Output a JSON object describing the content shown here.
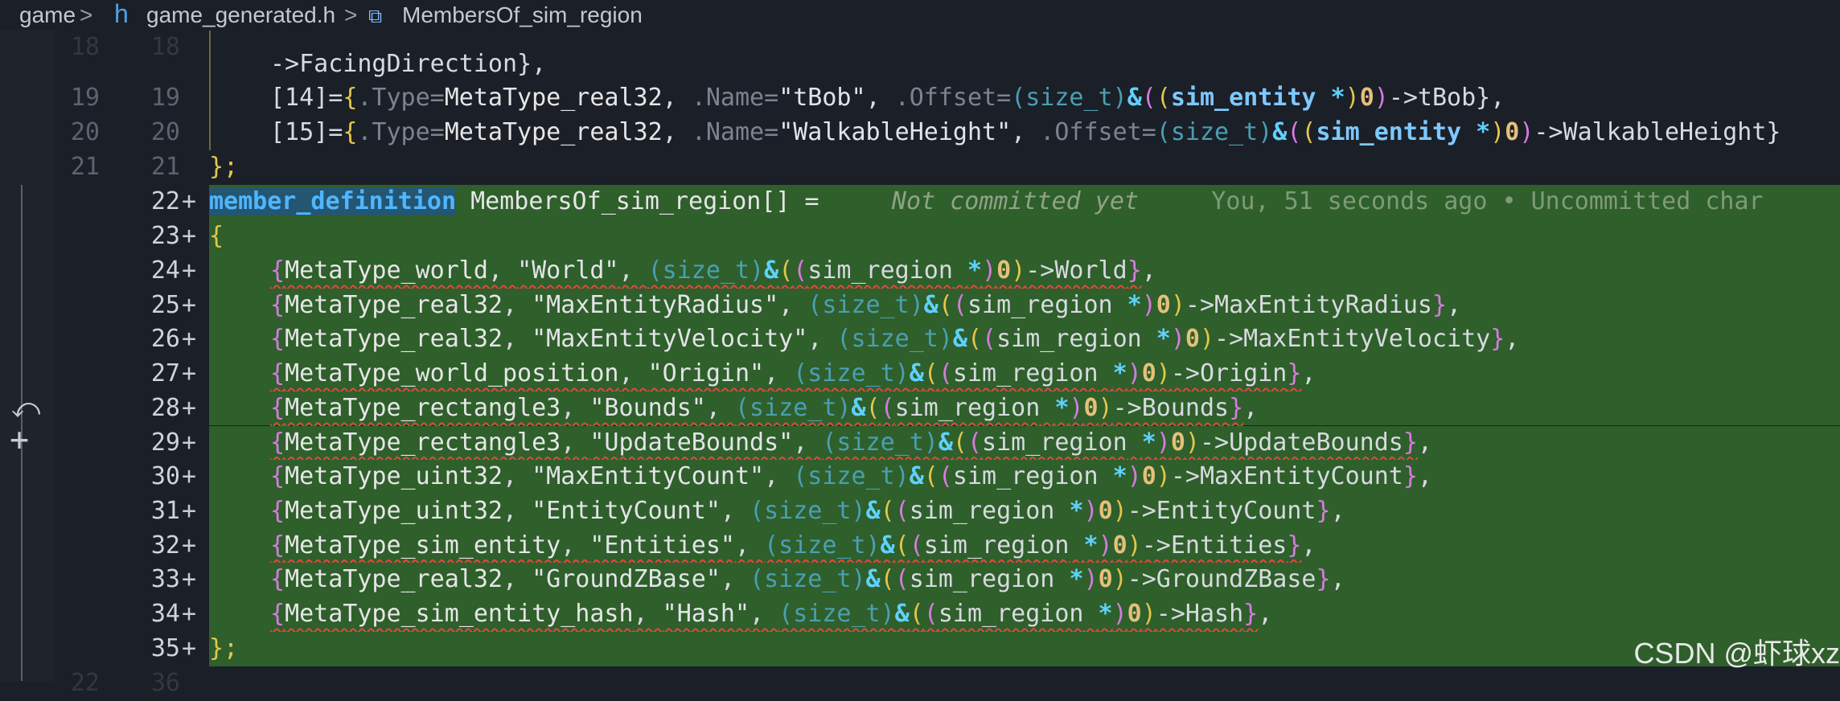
{
  "breadcrumb": {
    "root": "game",
    "separator": ">",
    "file_icon": "h",
    "file": "game_generated.h",
    "symbol_icon": "struct-icon",
    "symbol": "MembersOf_sim_region"
  },
  "top_lines": {
    "partial_line_no": "18",
    "line17_cont": "->FacingDirection},",
    "l19_no": "19",
    "l19_index": "[14]=",
    "l19_type": "MetaType_real32",
    "l19_name": "\"tBob\"",
    "l19_member": "->tBob},",
    "l20_no": "20",
    "l20_index": "[15]=",
    "l20_type": "MetaType_real32",
    "l20_name": "\"WalkableHeight\"",
    "l20_member": "->WalkableHeight}",
    "l21_no": "21",
    "l21_code": "};",
    "bottom_partial_no": "22",
    "bottom_partial_no2": "36"
  },
  "tokens": {
    "type_kw": ".Type=",
    "name_kw": ".Name=",
    "offset_kw": ".Offset=",
    "cast": "(size_t)",
    "amp": "&",
    "sim_entity": "sim_entity",
    "ptr": "*",
    "zero": "0",
    "sim_region": "sim_region"
  },
  "definition": {
    "line_no": "22",
    "keyword": "member_definition",
    "name": "MembersOf_sim_region[] =",
    "blame_text": "Not committed yet",
    "blame_detail": "You, 51 seconds ago • Uncommitted char",
    "open_line_no": "23",
    "open": "{",
    "close_line_no": "35",
    "close": "};"
  },
  "members": [
    {
      "line": "24",
      "type": "MetaType_world",
      "name": "\"World\"",
      "field": "->World",
      "squiggle": true
    },
    {
      "line": "25",
      "type": "MetaType_real32",
      "name": "\"MaxEntityRadius\"",
      "field": "->MaxEntityRadius",
      "squiggle": false
    },
    {
      "line": "26",
      "type": "MetaType_real32",
      "name": "\"MaxEntityVelocity\"",
      "field": "->MaxEntityVelocity",
      "squiggle": false
    },
    {
      "line": "27",
      "type": "MetaType_world_position",
      "name": "\"Origin\"",
      "field": "->Origin",
      "squiggle": true
    },
    {
      "line": "28",
      "type": "MetaType_rectangle3",
      "name": "\"Bounds\"",
      "field": "->Bounds",
      "squiggle": true
    },
    {
      "line": "29",
      "type": "MetaType_rectangle3",
      "name": "\"UpdateBounds\"",
      "field": "->UpdateBounds",
      "squiggle": true
    },
    {
      "line": "30",
      "type": "MetaType_uint32",
      "name": "\"MaxEntityCount\"",
      "field": "->MaxEntityCount",
      "squiggle": false
    },
    {
      "line": "31",
      "type": "MetaType_uint32",
      "name": "\"EntityCount\"",
      "field": "->EntityCount",
      "squiggle": false
    },
    {
      "line": "32",
      "type": "MetaType_sim_entity",
      "name": "\"Entities\"",
      "field": "->Entities",
      "squiggle": true
    },
    {
      "line": "33",
      "type": "MetaType_real32",
      "name": "\"GroundZBase\"",
      "field": "->GroundZBase",
      "squiggle": false
    },
    {
      "line": "34",
      "type": "MetaType_sim_entity_hash",
      "name": "\"Hash\"",
      "field": "->Hash",
      "squiggle": true
    }
  ],
  "scm": {
    "revert_icon": "undo-icon",
    "stage_icon": "plus-icon"
  },
  "watermark": "CSDN @虾球xz"
}
